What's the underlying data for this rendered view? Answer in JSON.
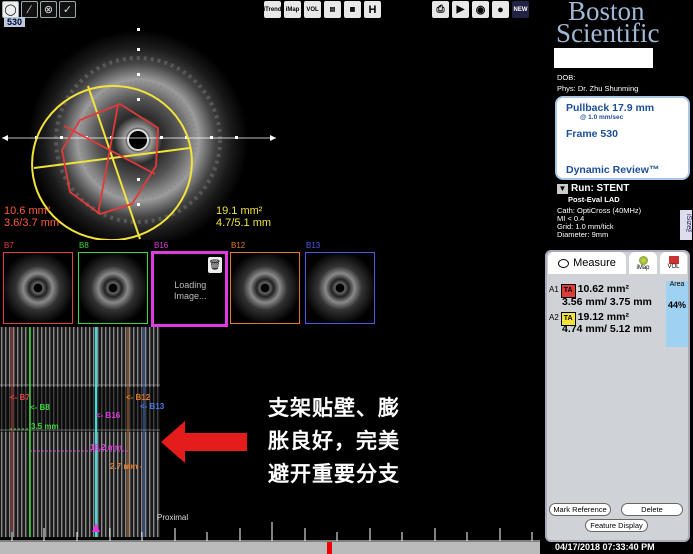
{
  "toolbar": {
    "frame_badge": "530",
    "left_tools": [
      "circle-tool-icon",
      "line-tool-icon",
      "crosshair-tool-icon",
      "check-tool-icon"
    ],
    "right_tools": [
      {
        "name": "iTrend-icon",
        "label": "iTrend"
      },
      {
        "name": "iMap-icon",
        "label": "iMap"
      },
      {
        "name": "vol-icon",
        "label": "VOL"
      },
      {
        "name": "split-view-icon",
        "label": ""
      },
      {
        "name": "grid-view-icon",
        "label": ""
      },
      {
        "name": "long-view-icon",
        "label": "H"
      }
    ],
    "right_tools2": [
      {
        "name": "print-icon",
        "label": ""
      },
      {
        "name": "export-icon",
        "label": ""
      },
      {
        "name": "disc-icon",
        "label": ""
      },
      {
        "name": "record-icon",
        "label": ""
      },
      {
        "name": "new-icon",
        "label": "NEW"
      }
    ]
  },
  "cross_section": {
    "lumen_area": "10.6 mm²",
    "lumen_diam": "3.6/3.7 mm",
    "vessel_area": "19.1 mm²",
    "vessel_diam": "4.7/5.1 mm"
  },
  "bookmarks": [
    {
      "label": "B7",
      "color": "#e04040"
    },
    {
      "label": "B8",
      "color": "#3ad83a"
    },
    {
      "label": "B16",
      "color": "#e03ae0"
    },
    {
      "label": "B12",
      "color": "#e07a2a"
    },
    {
      "label": "B13",
      "color": "#4a5ae8"
    }
  ],
  "loading_text": [
    "Loading",
    "Image..."
  ],
  "longitudinal": {
    "markers": [
      {
        "label": "<- B7",
        "color": "#e04040"
      },
      {
        "label": "<- B8",
        "color": "#3ad83a"
      },
      {
        "label": "<- B16",
        "color": "#e03ae0"
      },
      {
        "label": "<- B12",
        "color": "#e07a2a"
      },
      {
        "label": "<- B13",
        "color": "#4a7ae8"
      }
    ],
    "len1": "3.5 mm",
    "len2": "18.2 mm",
    "len3": "2.7 mm",
    "proximal": "Proximal"
  },
  "annotation": [
    "支架贴壁、膨",
    "胀良好，完美",
    "避开重要分支"
  ],
  "brand": {
    "line1": "Boston",
    "line2": "Scientific"
  },
  "patient": {
    "dob": "DOB:",
    "phys": "Phys:   Dr. Zhu Shunming"
  },
  "pullback": {
    "title": "Pullback 17.9 mm",
    "speed": "@ 1.0 mm/sec",
    "frame": "Frame 530",
    "mode": "Dynamic Review™"
  },
  "run": {
    "title": "Run: STENT",
    "sub": "Post-Eval LAD",
    "cath": "Cath: OptiCross (40MHz)",
    "mi": "MI <   0.4",
    "grid": "Grid:    1.0 mm/tick",
    "diameter": "Diameter:   9mm"
  },
  "isize": "iSize™",
  "measure_panel": {
    "tabs": [
      "Measure",
      "iMap",
      "VOL"
    ],
    "a1_key": "A1",
    "a1_tag": "TA",
    "a1_area": "10.62 mm²",
    "a1_diam": "3.56 mm/ 3.75 mm",
    "a2_key": "A2",
    "a2_tag": "TA",
    "a2_area": "19.12 mm²",
    "a2_diam": "4.74 mm/ 5.12 mm",
    "area_label": "Area",
    "area_value": "44%",
    "mark_ref": "Mark Reference",
    "delete": "Delete",
    "feature_display": "Feature Display"
  },
  "datetime": "04/17/2018 07:33:40 PM",
  "colors": {
    "red": "#e03a3a",
    "yellow": "#f2e23a",
    "accent_blue": "#1d4e9a"
  }
}
